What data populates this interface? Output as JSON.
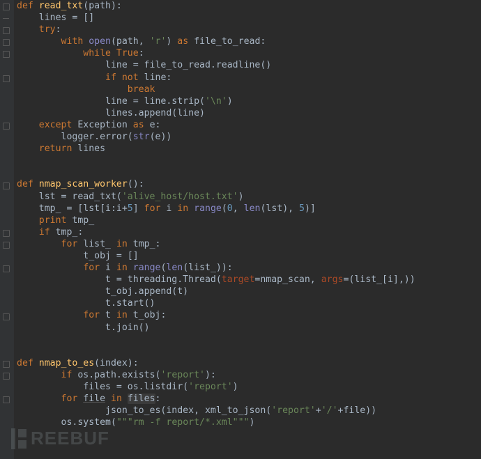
{
  "lang": "python",
  "watermark": "REEBUF",
  "tokens": [
    [
      [
        "kw",
        "def "
      ],
      [
        "fn",
        "read_txt"
      ],
      [
        "txt",
        "(path):"
      ]
    ],
    [
      [
        "txt",
        "    lines = []"
      ]
    ],
    [
      [
        "txt",
        "    "
      ],
      [
        "kw",
        "try"
      ],
      [
        "txt",
        ":"
      ]
    ],
    [
      [
        "txt",
        "        "
      ],
      [
        "kw",
        "with "
      ],
      [
        "builtin",
        "open"
      ],
      [
        "txt",
        "(path, "
      ],
      [
        "str",
        "'r'"
      ],
      [
        "txt",
        ") "
      ],
      [
        "kw",
        "as "
      ],
      [
        "txt",
        "file_to_read:"
      ]
    ],
    [
      [
        "txt",
        "            "
      ],
      [
        "kw",
        "while "
      ],
      [
        "kw",
        "True"
      ],
      [
        "txt",
        ":"
      ]
    ],
    [
      [
        "txt",
        "                line = file_to_read.readline()"
      ]
    ],
    [
      [
        "txt",
        "                "
      ],
      [
        "kw",
        "if not "
      ],
      [
        "txt",
        "line:"
      ]
    ],
    [
      [
        "txt",
        "                    "
      ],
      [
        "kw",
        "break"
      ]
    ],
    [
      [
        "txt",
        "                line = line.strip("
      ],
      [
        "str",
        "'\\n'"
      ],
      [
        "txt",
        ")"
      ]
    ],
    [
      [
        "txt",
        "                lines.append(line)"
      ]
    ],
    [
      [
        "txt",
        "    "
      ],
      [
        "kw",
        "except "
      ],
      [
        "txt",
        "Exception "
      ],
      [
        "kw",
        "as "
      ],
      [
        "txt",
        "e:"
      ]
    ],
    [
      [
        "txt",
        "        logger.error("
      ],
      [
        "builtin",
        "str"
      ],
      [
        "txt",
        "(e))"
      ]
    ],
    [
      [
        "txt",
        "    "
      ],
      [
        "kw",
        "return "
      ],
      [
        "txt",
        "lines"
      ]
    ],
    [],
    [],
    [
      [
        "kw",
        "def "
      ],
      [
        "fn",
        "nmap_scan_worker"
      ],
      [
        "txt",
        "():"
      ]
    ],
    [
      [
        "txt",
        "    lst = read_txt("
      ],
      [
        "str",
        "'alive_host/host.txt'"
      ],
      [
        "txt",
        ")"
      ]
    ],
    [
      [
        "txt",
        "    tmp_ = [lst[i:i+"
      ],
      [
        "num",
        "5"
      ],
      [
        "txt",
        "] "
      ],
      [
        "kw",
        "for "
      ],
      [
        "txt",
        "i "
      ],
      [
        "kw",
        "in "
      ],
      [
        "builtin",
        "range"
      ],
      [
        "txt",
        "("
      ],
      [
        "num",
        "0"
      ],
      [
        "txt",
        ", "
      ],
      [
        "builtin",
        "len"
      ],
      [
        "txt",
        "(lst), "
      ],
      [
        "num",
        "5"
      ],
      [
        "txt",
        ")]"
      ]
    ],
    [
      [
        "txt",
        "    "
      ],
      [
        "kw",
        "print "
      ],
      [
        "txt",
        "tmp_"
      ]
    ],
    [
      [
        "txt",
        "    "
      ],
      [
        "kw",
        "if "
      ],
      [
        "txt",
        "tmp_:"
      ]
    ],
    [
      [
        "txt",
        "        "
      ],
      [
        "kw",
        "for "
      ],
      [
        "txt",
        "list_ "
      ],
      [
        "kw",
        "in "
      ],
      [
        "txt",
        "tmp_:"
      ]
    ],
    [
      [
        "txt",
        "            t_obj = []"
      ]
    ],
    [
      [
        "txt",
        "            "
      ],
      [
        "kw",
        "for "
      ],
      [
        "txt",
        "i "
      ],
      [
        "kw",
        "in "
      ],
      [
        "builtin",
        "range"
      ],
      [
        "txt",
        "("
      ],
      [
        "builtin",
        "len"
      ],
      [
        "txt",
        "(list_)):"
      ]
    ],
    [
      [
        "txt",
        "                t = threading.Thread("
      ],
      [
        "param",
        "target"
      ],
      [
        "txt",
        "=nmap_scan, "
      ],
      [
        "param",
        "args"
      ],
      [
        "txt",
        "=(list_[i],))"
      ]
    ],
    [
      [
        "txt",
        "                t_obj.append(t)"
      ]
    ],
    [
      [
        "txt",
        "                t.start()"
      ]
    ],
    [
      [
        "txt",
        "            "
      ],
      [
        "kw",
        "for "
      ],
      [
        "txt",
        "t "
      ],
      [
        "kw",
        "in "
      ],
      [
        "txt",
        "t_obj:"
      ]
    ],
    [
      [
        "txt",
        "                t.join()"
      ]
    ],
    [],
    [],
    [
      [
        "kw",
        "def "
      ],
      [
        "fn",
        "nmap_to_es"
      ],
      [
        "txt",
        "(index):"
      ]
    ],
    [
      [
        "txt",
        "        "
      ],
      [
        "kw",
        "if "
      ],
      [
        "txt",
        "os.path.exists("
      ],
      [
        "str",
        "'report'"
      ],
      [
        "txt",
        "):"
      ]
    ],
    [
      [
        "txt",
        "            files = os.listdir("
      ],
      [
        "str",
        "'report'"
      ],
      [
        "txt",
        ")"
      ]
    ],
    [
      [
        "txt",
        "        "
      ],
      [
        "kw",
        "for "
      ],
      [
        "txt underline",
        "file"
      ],
      [
        "txt",
        " "
      ],
      [
        "kw",
        "in "
      ],
      [
        "txt highlight",
        "files"
      ],
      [
        "txt",
        ":"
      ]
    ],
    [
      [
        "txt",
        "                json_to_es(index, xml_to_json("
      ],
      [
        "str",
        "'report'"
      ],
      [
        "txt",
        "+"
      ],
      [
        "str",
        "'/'"
      ],
      [
        "txt",
        "+file))"
      ]
    ],
    [
      [
        "txt",
        "        os.system("
      ],
      [
        "str",
        "\"\"\"rm -f report/*.xml\"\"\""
      ],
      [
        "txt",
        ")"
      ]
    ],
    []
  ],
  "gutter_marks": [
    {
      "line": 0,
      "open": true
    },
    {
      "line": 1,
      "open": false
    },
    {
      "line": 2,
      "open": true
    },
    {
      "line": 3,
      "open": true
    },
    {
      "line": 4,
      "open": true
    },
    {
      "line": 6,
      "open": true
    },
    {
      "line": 10,
      "open": true
    },
    {
      "line": 15,
      "open": true
    },
    {
      "line": 19,
      "open": true
    },
    {
      "line": 20,
      "open": true
    },
    {
      "line": 22,
      "open": true
    },
    {
      "line": 26,
      "open": true
    },
    {
      "line": 30,
      "open": true
    },
    {
      "line": 31,
      "open": true
    },
    {
      "line": 33,
      "open": true
    }
  ]
}
